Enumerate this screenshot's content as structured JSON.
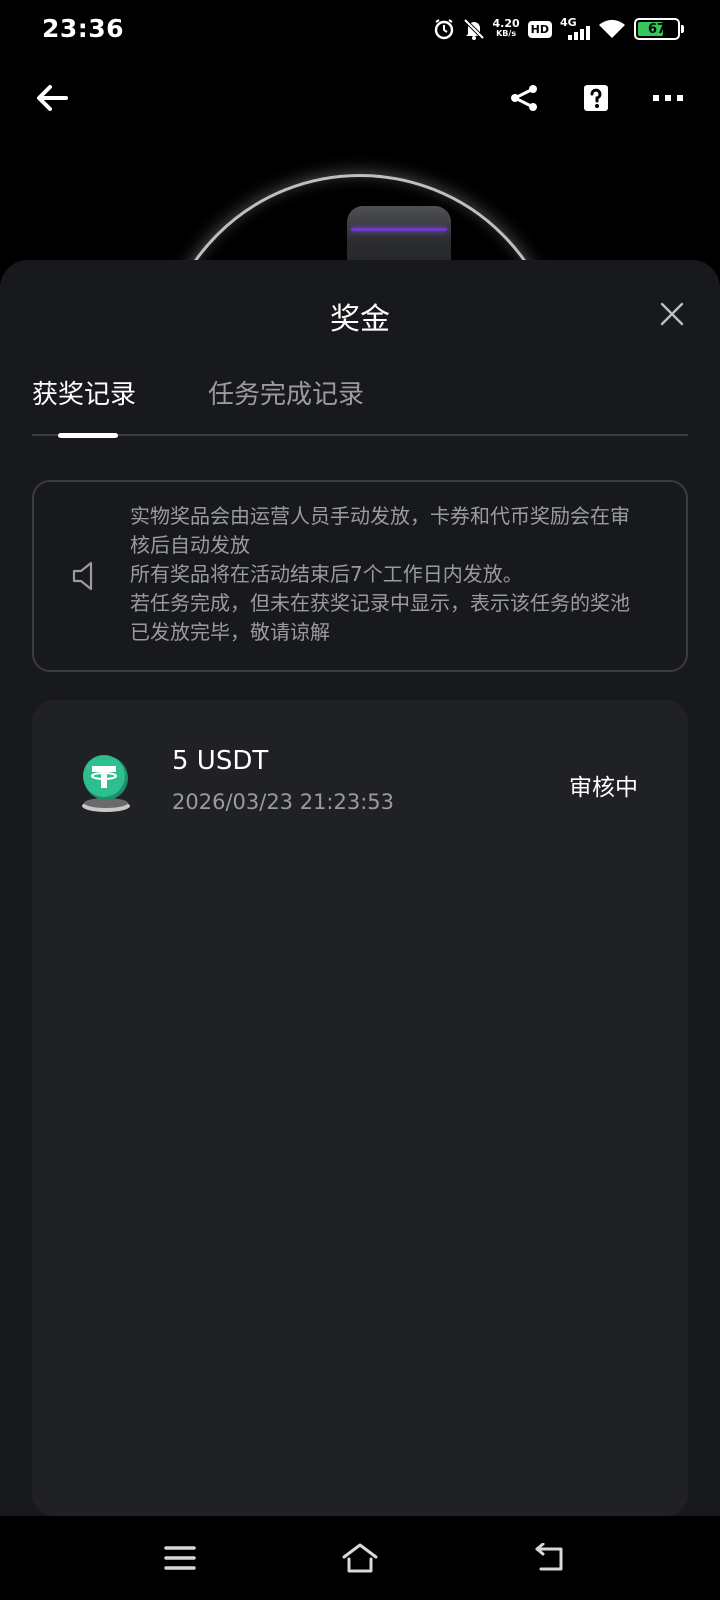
{
  "status_bar": {
    "time": "23:36",
    "net_speed_value": "4.20",
    "net_speed_unit": "KB/s",
    "hd_label": "HD",
    "network_type": "4G",
    "battery_level": "67",
    "icons": [
      "alarm-icon",
      "mute-bell-icon",
      "hd-icon",
      "signal-icon",
      "wifi-icon",
      "battery-icon"
    ]
  },
  "app_bar": {
    "icons": [
      "back-arrow-icon",
      "share-icon",
      "help-icon",
      "more-icon"
    ]
  },
  "sheet": {
    "title": "奖金",
    "tabs": [
      {
        "label": "获奖记录",
        "active": true
      },
      {
        "label": "任务完成记录",
        "active": false
      }
    ],
    "notice": {
      "icon": "speaker-icon",
      "lines": [
        "实物奖品会由运营人员手动发放，卡券和代币奖励会在审核后自动发放",
        "所有奖品将在活动结束后7个工作日内发放。",
        "若任务完成，但未在获奖记录中显示，表示该任务的奖池已发放完毕，敬请谅解"
      ]
    },
    "records": [
      {
        "icon": "usdt-coin-icon",
        "amount": "5 USDT",
        "time": "2026/03/23 21:23:53",
        "status": "审核中"
      }
    ]
  },
  "colors": {
    "sheet_bg": "#18191c",
    "card_bg": "#202125",
    "muted_text": "#9a9ba1",
    "coin_green": "#2fbf8f",
    "battery_green": "#34c759"
  },
  "nav_bar": {
    "icons": [
      "menu-icon",
      "home-icon",
      "back-icon"
    ]
  }
}
